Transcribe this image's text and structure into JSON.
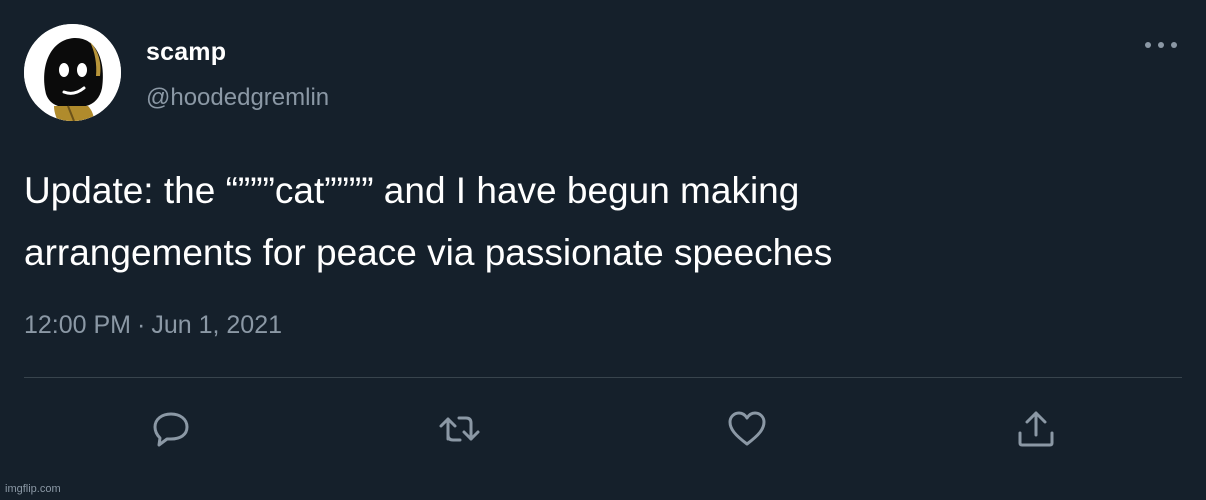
{
  "tweet": {
    "display_name": "scamp",
    "handle": "@hoodedgremlin",
    "text_lines": [
      "Update: the “”””cat”””” and I have begun making",
      "arrangements for peace via passionate speeches"
    ],
    "time": "12:00 PM",
    "separator": "·",
    "date": "Jun 1, 2021"
  },
  "actions": [
    {
      "name": "reply",
      "icon": "reply-icon"
    },
    {
      "name": "retweet",
      "icon": "retweet-icon"
    },
    {
      "name": "like",
      "icon": "heart-icon"
    },
    {
      "name": "share",
      "icon": "share-icon"
    }
  ],
  "watermark": "imgflip.com",
  "colors": {
    "background": "#15202b",
    "primary_text": "#ffffff",
    "secondary_text": "#8b98a5",
    "divider": "#38444d"
  }
}
